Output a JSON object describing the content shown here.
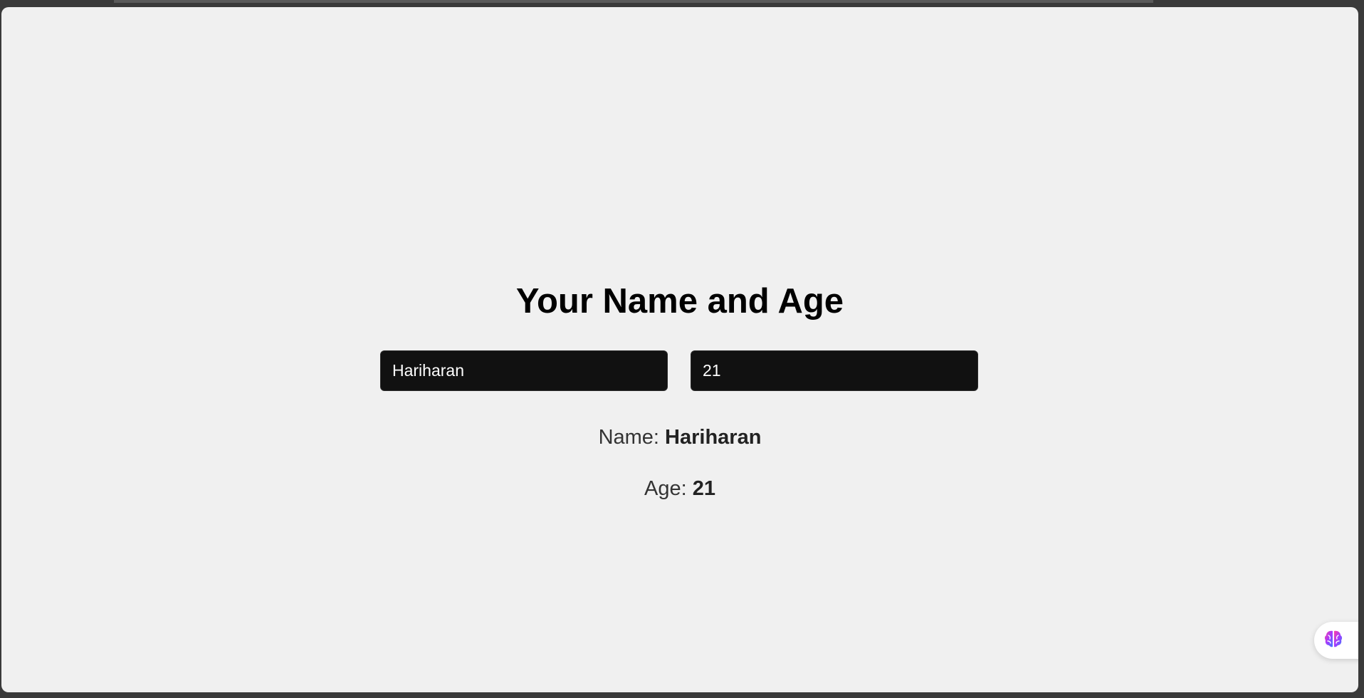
{
  "page": {
    "title": "Your Name and Age"
  },
  "inputs": {
    "name_value": "Hariharan",
    "age_value": "21"
  },
  "display": {
    "name_label": "Name: ",
    "name_value": "Hariharan",
    "age_label": "Age: ",
    "age_value": "21"
  },
  "extension": {
    "icon": "brain-icon"
  },
  "colors": {
    "background": "#f0f0f0",
    "input_background": "#111111",
    "input_text": "#ffffff"
  }
}
